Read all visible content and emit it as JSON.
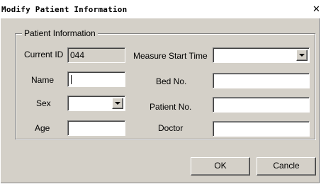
{
  "window": {
    "title": "Modify Patient Information",
    "close_glyph": "✕"
  },
  "group": {
    "legend": "Patient Information"
  },
  "fields": {
    "current_id": {
      "label": "Current ID",
      "value": "044"
    },
    "name": {
      "label": "Name",
      "value": ""
    },
    "sex": {
      "label": "Sex",
      "value": ""
    },
    "age": {
      "label": "Age",
      "value": ""
    },
    "measure_start_time": {
      "label": "Measure Start Time",
      "value": ""
    },
    "bed_no": {
      "label": "Bed No.",
      "value": ""
    },
    "patient_no": {
      "label": "Patient No.",
      "value": ""
    },
    "doctor": {
      "label": "Doctor",
      "value": ""
    }
  },
  "buttons": {
    "ok": "OK",
    "cancel": "Cancle"
  },
  "icons": {
    "close": "close-icon",
    "dropdown": "chevron-down-icon"
  },
  "colors": {
    "window_face": "#d4d0c8",
    "field_background": "#ffffff"
  }
}
